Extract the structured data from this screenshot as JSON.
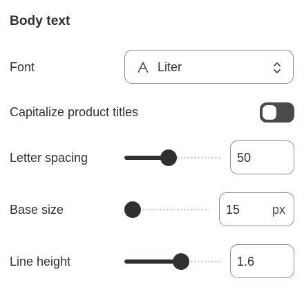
{
  "section": {
    "title": "Body text"
  },
  "font": {
    "label": "Font",
    "value": "Liter",
    "icon": "font-letter-icon"
  },
  "capitalize": {
    "label": "Capitalize product titles",
    "enabled": false
  },
  "letter_spacing": {
    "label": "Letter spacing",
    "value": "50",
    "level": 0.45
  },
  "base_size": {
    "label": "Base size",
    "value": "15",
    "unit": "px",
    "level": 0.0
  },
  "line_height": {
    "label": "Line height",
    "value": "1.6",
    "level": 0.6
  },
  "colors": {
    "text": "#303030",
    "control_dark": "#303030",
    "border": "#8a8a8a",
    "track_dots": "#cfcfcf"
  }
}
